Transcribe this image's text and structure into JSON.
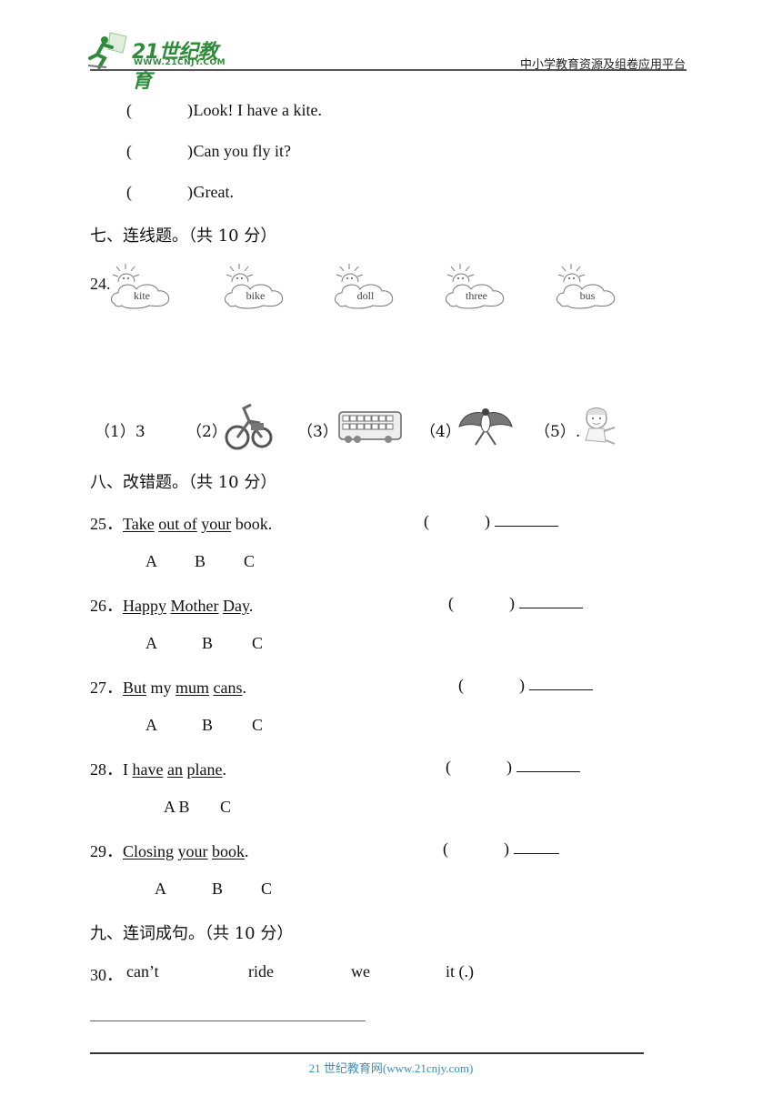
{
  "header": {
    "logo_title": "21世纪教育",
    "logo_url": "WWW.21CNJY.COM",
    "platform": "中小学教育资源及组卷应用平台",
    "brand_color": "#2e8b3a"
  },
  "dialogue": [
    {
      "paren_open": "(",
      "paren_close": ")",
      "text": "Look! I have a kite."
    },
    {
      "paren_open": "(",
      "paren_close": ")",
      "text": "Can you fly it?"
    },
    {
      "paren_open": "(",
      "paren_close": ")",
      "text": "Great."
    }
  ],
  "section7": {
    "title": "七、连线题。（共 10 分）",
    "question_number": "24.",
    "clouds": [
      "kite",
      "bike",
      "doll",
      "three",
      "bus"
    ],
    "pictures": [
      {
        "label": "（1）3",
        "icon": "number-three"
      },
      {
        "label": "（2）",
        "icon": "bike-icon"
      },
      {
        "label": "（3）",
        "icon": "bus-icon"
      },
      {
        "label": "（4）",
        "icon": "kite-icon"
      },
      {
        "label": "（5）.",
        "icon": "doll-icon"
      }
    ]
  },
  "section8": {
    "title": "八、改错题。（共 10 分）",
    "questions": [
      {
        "num": "25．",
        "parts": [
          {
            "t": "Take",
            "u": true
          },
          {
            "t": " ",
            "u": false
          },
          {
            "t": "out of",
            "u": true
          },
          {
            "t": " ",
            "u": false
          },
          {
            "t": "your",
            "u": true
          },
          {
            "t": " book.",
            "u": false
          }
        ],
        "choices": [
          "A",
          "B",
          "C"
        ]
      },
      {
        "num": "26．",
        "parts": [
          {
            "t": "Happy",
            "u": true
          },
          {
            "t": " ",
            "u": false
          },
          {
            "t": "Mother",
            "u": true
          },
          {
            "t": " ",
            "u": false
          },
          {
            "t": "Day",
            "u": true
          },
          {
            "t": ".",
            "u": false
          }
        ],
        "choices": [
          "A",
          "B",
          "C"
        ]
      },
      {
        "num": "27．",
        "parts": [
          {
            "t": "But",
            "u": true
          },
          {
            "t": " my ",
            "u": false
          },
          {
            "t": "mum",
            "u": true
          },
          {
            "t": " ",
            "u": false
          },
          {
            "t": "cans",
            "u": true
          },
          {
            "t": ".",
            "u": false
          }
        ],
        "choices": [
          "A",
          "B",
          "C"
        ]
      },
      {
        "num": "28．",
        "parts": [
          {
            "t": "I ",
            "u": false
          },
          {
            "t": "have",
            "u": true
          },
          {
            "t": " ",
            "u": false
          },
          {
            "t": "an",
            "u": true
          },
          {
            "t": " ",
            "u": false
          },
          {
            "t": "plane",
            "u": true
          },
          {
            "t": ".",
            "u": false
          }
        ],
        "choices": [
          "A B",
          "C"
        ]
      },
      {
        "num": "29．",
        "parts": [
          {
            "t": "Closing",
            "u": true
          },
          {
            "t": " ",
            "u": false
          },
          {
            "t": "your",
            "u": true
          },
          {
            "t": " ",
            "u": false
          },
          {
            "t": "book",
            "u": true
          },
          {
            "t": ".",
            "u": false
          }
        ],
        "choices": [
          "A",
          "B",
          "C"
        ]
      }
    ],
    "paren_open": "(",
    "paren_close": ")"
  },
  "section9": {
    "title": "九、连词成句。（共 10 分）",
    "question_number": "30．",
    "words": [
      "can’t",
      "ride",
      "we",
      "it (.)"
    ]
  },
  "footer": {
    "text": "21 世纪教育网(www.21cnjy.com)",
    "color": "#3a8fb7"
  }
}
